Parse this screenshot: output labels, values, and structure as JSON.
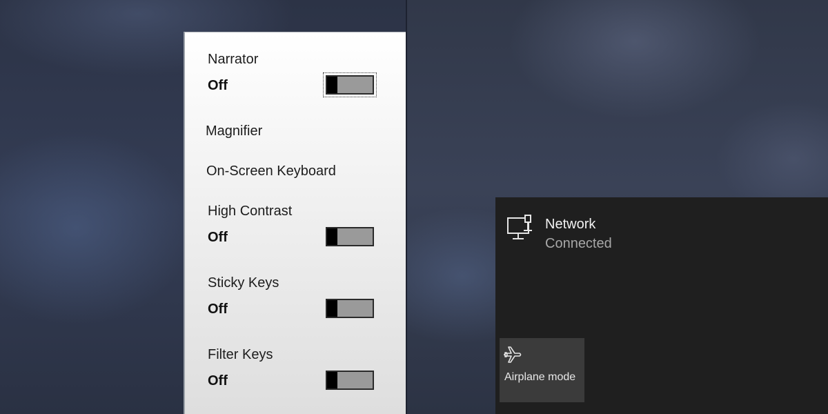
{
  "accessibility_panel": {
    "items": [
      {
        "label": "Narrator",
        "state": "Off",
        "toggle_on": false
      },
      {
        "label": "Magnifier"
      },
      {
        "label": "On-Screen Keyboard"
      },
      {
        "label": "High Contrast",
        "state": "Off",
        "toggle_on": false
      },
      {
        "label": "Sticky Keys",
        "state": "Off",
        "toggle_on": false
      },
      {
        "label": "Filter Keys",
        "state": "Off",
        "toggle_on": false
      }
    ]
  },
  "network_panel": {
    "title": "Network",
    "status": "Connected",
    "network_icon": "wired-network-icon",
    "quick_action": {
      "label": "Airplane mode",
      "icon": "airplane-icon"
    }
  },
  "colors": {
    "flyout_light": "#f0f0f0",
    "toggle_track": "#9a9a9a",
    "toggle_thumb": "#000000",
    "net_panel_bg": "#1f1f1f",
    "tile_bg": "#3b3b3b"
  }
}
